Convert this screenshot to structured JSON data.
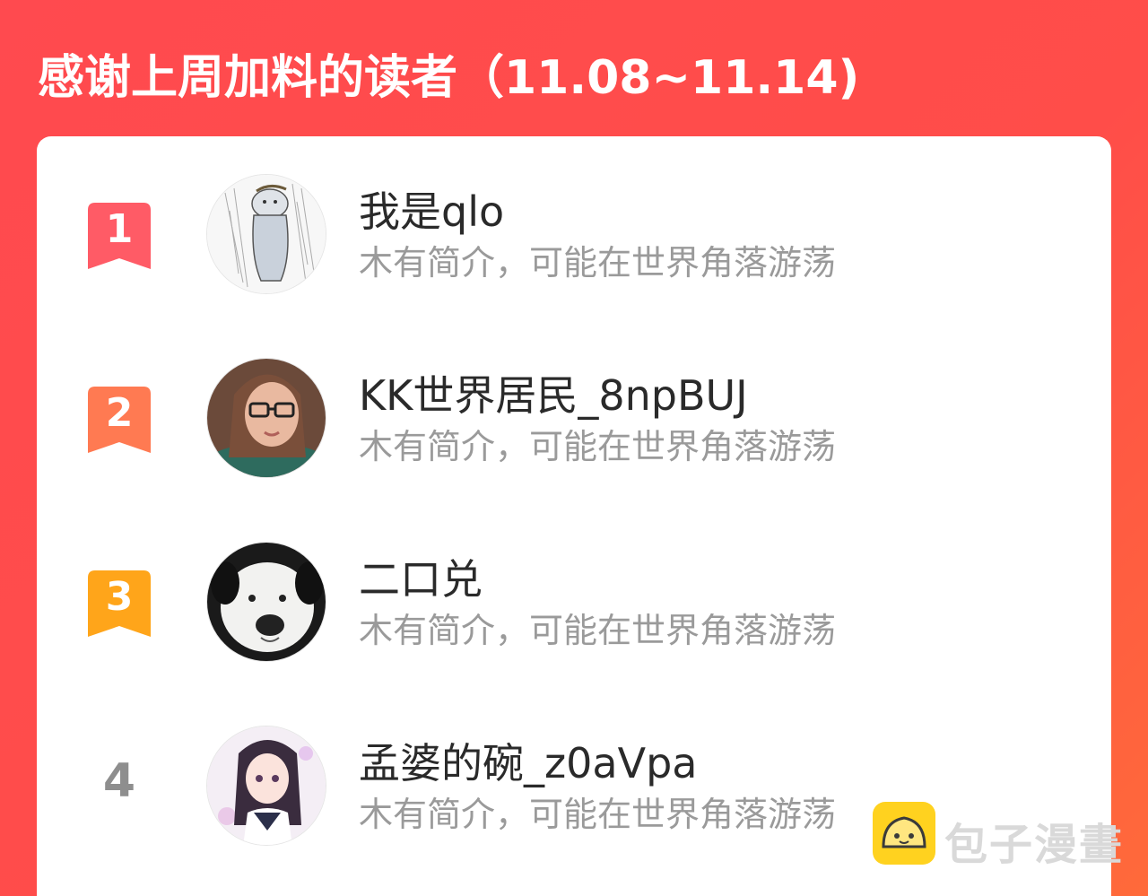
{
  "header": {
    "title": "感谢上周加料的读者（11.08~11.14)"
  },
  "colors": {
    "background_start": "#ff4a4f",
    "background_end": "#ff6a3a",
    "rank1": "#ff5b66",
    "rank2": "#ff7a52",
    "rank3": "#ffa51a",
    "rank_plain": "#8e8e8e"
  },
  "readers": [
    {
      "rank": "1",
      "name": "我是qlo",
      "bio": "木有简介，可能在世界角落游荡",
      "avatar_icon": "sketch-character-avatar"
    },
    {
      "rank": "2",
      "name": "KK世界居民_8npBUJ",
      "bio": "木有简介，可能在世界角落游荡",
      "avatar_icon": "woman-with-glasses-avatar"
    },
    {
      "rank": "3",
      "name": "二口兑",
      "bio": "木有简介，可能在世界角落游荡",
      "avatar_icon": "white-dog-avatar"
    },
    {
      "rank": "4",
      "name": "孟婆的碗_z0aVpa",
      "bio": "木有简介，可能在世界角落游荡",
      "avatar_icon": "anime-girl-avatar"
    }
  ],
  "watermark": {
    "text": "包子漫畫",
    "icon": "baozi-logo-icon"
  }
}
